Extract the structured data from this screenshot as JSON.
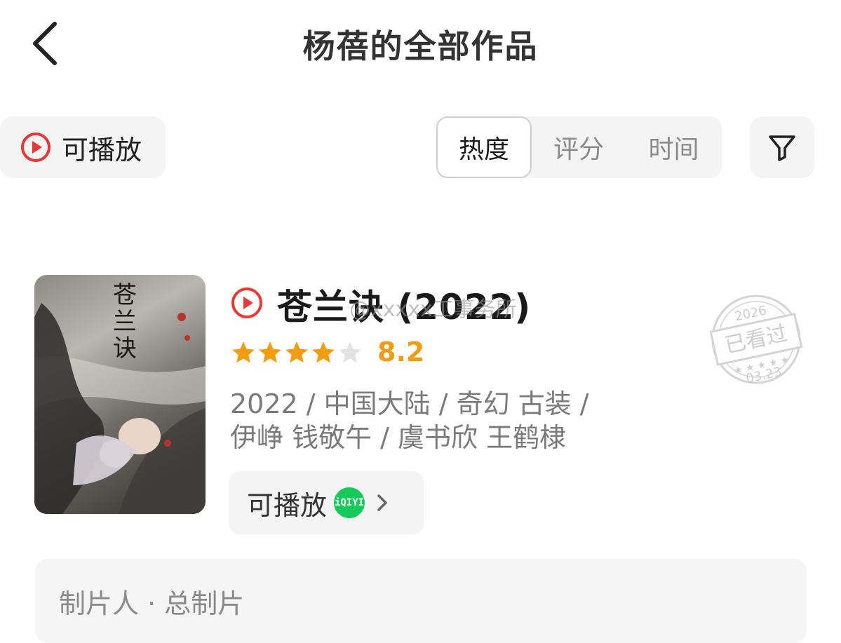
{
  "header": {
    "title": "杨蓓的全部作品"
  },
  "filters": {
    "playable_label": "可播放",
    "sort_tabs": [
      "热度",
      "评分",
      "时间"
    ],
    "active_sort": "热度"
  },
  "work": {
    "title": "苍兰诀 (2022)",
    "watermark": "@xxxxx工事务所",
    "rating": "8.2",
    "stars_filled": 4,
    "stars_total": 5,
    "meta_line1": "2022 / 中国大陆 / 奇幻 古装 /",
    "meta_line2": "伊峥 钱敬午 / 虞书欣 王鹤棣",
    "source_label": "可播放",
    "source_platform": "iQIYI",
    "source_icon": "iqiyi-icon",
    "poster_title": "苍兰诀",
    "stamp": {
      "year": "2026",
      "label": "已看过",
      "date": "03.23"
    }
  },
  "producer": {
    "text": "制片人 · 总制片"
  },
  "colors": {
    "accent_red": "#e53935",
    "star": "#f39c12",
    "iqiyi_green": "#16c95b"
  }
}
